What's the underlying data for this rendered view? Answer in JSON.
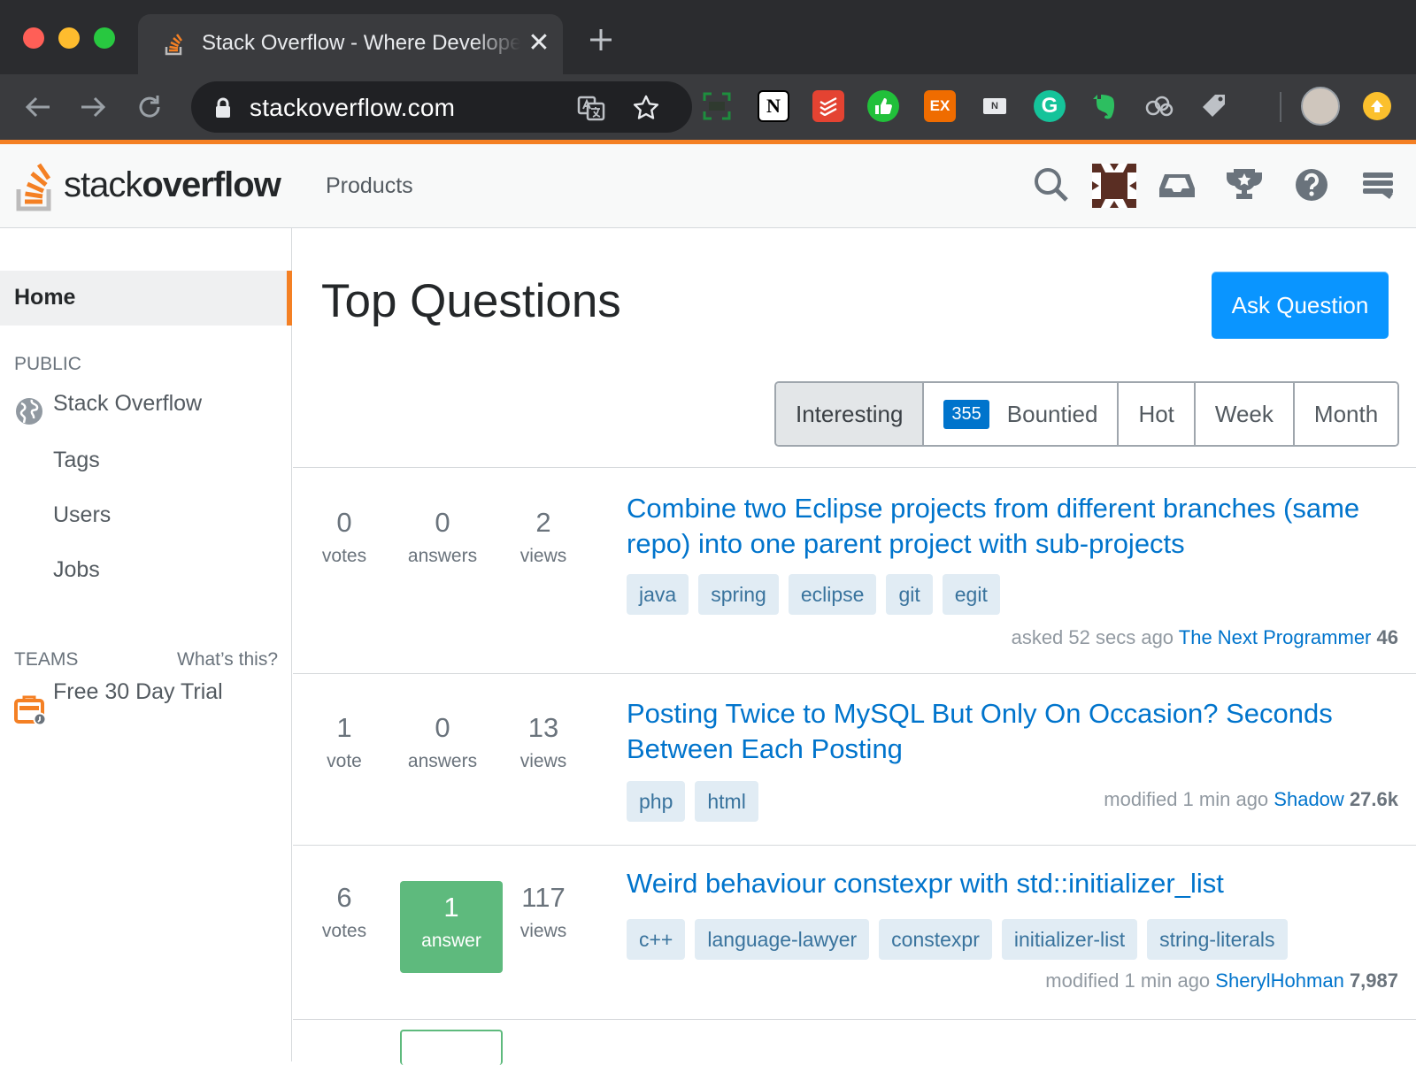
{
  "browser": {
    "tab_title": "Stack Overflow - Where Developers Learn, Share, & Build Careers",
    "url": "stackoverflow.com",
    "tab_close": "✕",
    "extensions": [
      {
        "name": "screenshot-extension",
        "label": ""
      },
      {
        "name": "notion-extension",
        "label": "N"
      },
      {
        "name": "todoist-extension",
        "label": ""
      },
      {
        "name": "thumbs-up-extension",
        "label": ""
      },
      {
        "name": "ex-extension",
        "label": "EX"
      },
      {
        "name": "news-extension",
        "label": "N"
      },
      {
        "name": "grammarly-extension",
        "label": "G"
      },
      {
        "name": "evernote-extension",
        "label": ""
      },
      {
        "name": "cloud-extension",
        "label": ""
      },
      {
        "name": "tag-extension",
        "label": ""
      }
    ]
  },
  "header": {
    "logo_light": "stack",
    "logo_bold": "overflow",
    "products": "Products"
  },
  "sidebar": {
    "home": "Home",
    "public_heading": "PUBLIC",
    "stack_overflow": "Stack Overflow",
    "tags": "Tags",
    "users": "Users",
    "jobs": "Jobs",
    "teams_heading": "TEAMS",
    "whats_this": "What’s this?",
    "free_trial": "Free 30 Day Trial"
  },
  "main": {
    "title": "Top Questions",
    "ask_button": "Ask Question",
    "filters": {
      "interesting": "Interesting",
      "bounty_count": "355",
      "bountied": "Bountied",
      "hot": "Hot",
      "week": "Week",
      "month": "Month"
    },
    "questions": [
      {
        "votes": "0",
        "votes_label": "votes",
        "answers": "0",
        "answers_label": "answers",
        "views": "2",
        "views_label": "views",
        "title": "Combine two Eclipse projects from different branches (same repo) into one parent project with sub-projects",
        "tags": [
          "java",
          "spring",
          "eclipse",
          "git",
          "egit"
        ],
        "action": "asked 52 secs ago",
        "user": "The Next Programmer",
        "rep": "46"
      },
      {
        "votes": "1",
        "votes_label": "vote",
        "answers": "0",
        "answers_label": "answers",
        "views": "13",
        "views_label": "views",
        "title": "Posting Twice to MySQL But Only On Occasion? Seconds Between Each Posting",
        "tags": [
          "php",
          "html"
        ],
        "action": "modified 1 min ago",
        "user": "Shadow",
        "rep": "27.6k"
      },
      {
        "votes": "6",
        "votes_label": "votes",
        "answers": "1",
        "answers_label": "answer",
        "views": "117",
        "views_label": "views",
        "title": "Weird behaviour constexpr with std::initializer_list",
        "tags": [
          "c++",
          "language-lawyer",
          "constexpr",
          "initializer-list",
          "string-literals"
        ],
        "action": "modified 1 min ago",
        "user": "SherylHohman",
        "rep": "7,987"
      }
    ]
  },
  "colors": {
    "brand_orange": "#f48024",
    "link_blue": "#0074cc",
    "button_blue": "#0a95ff",
    "accepted_green": "#5eba7d",
    "tag_bg": "#e1ecf4"
  }
}
